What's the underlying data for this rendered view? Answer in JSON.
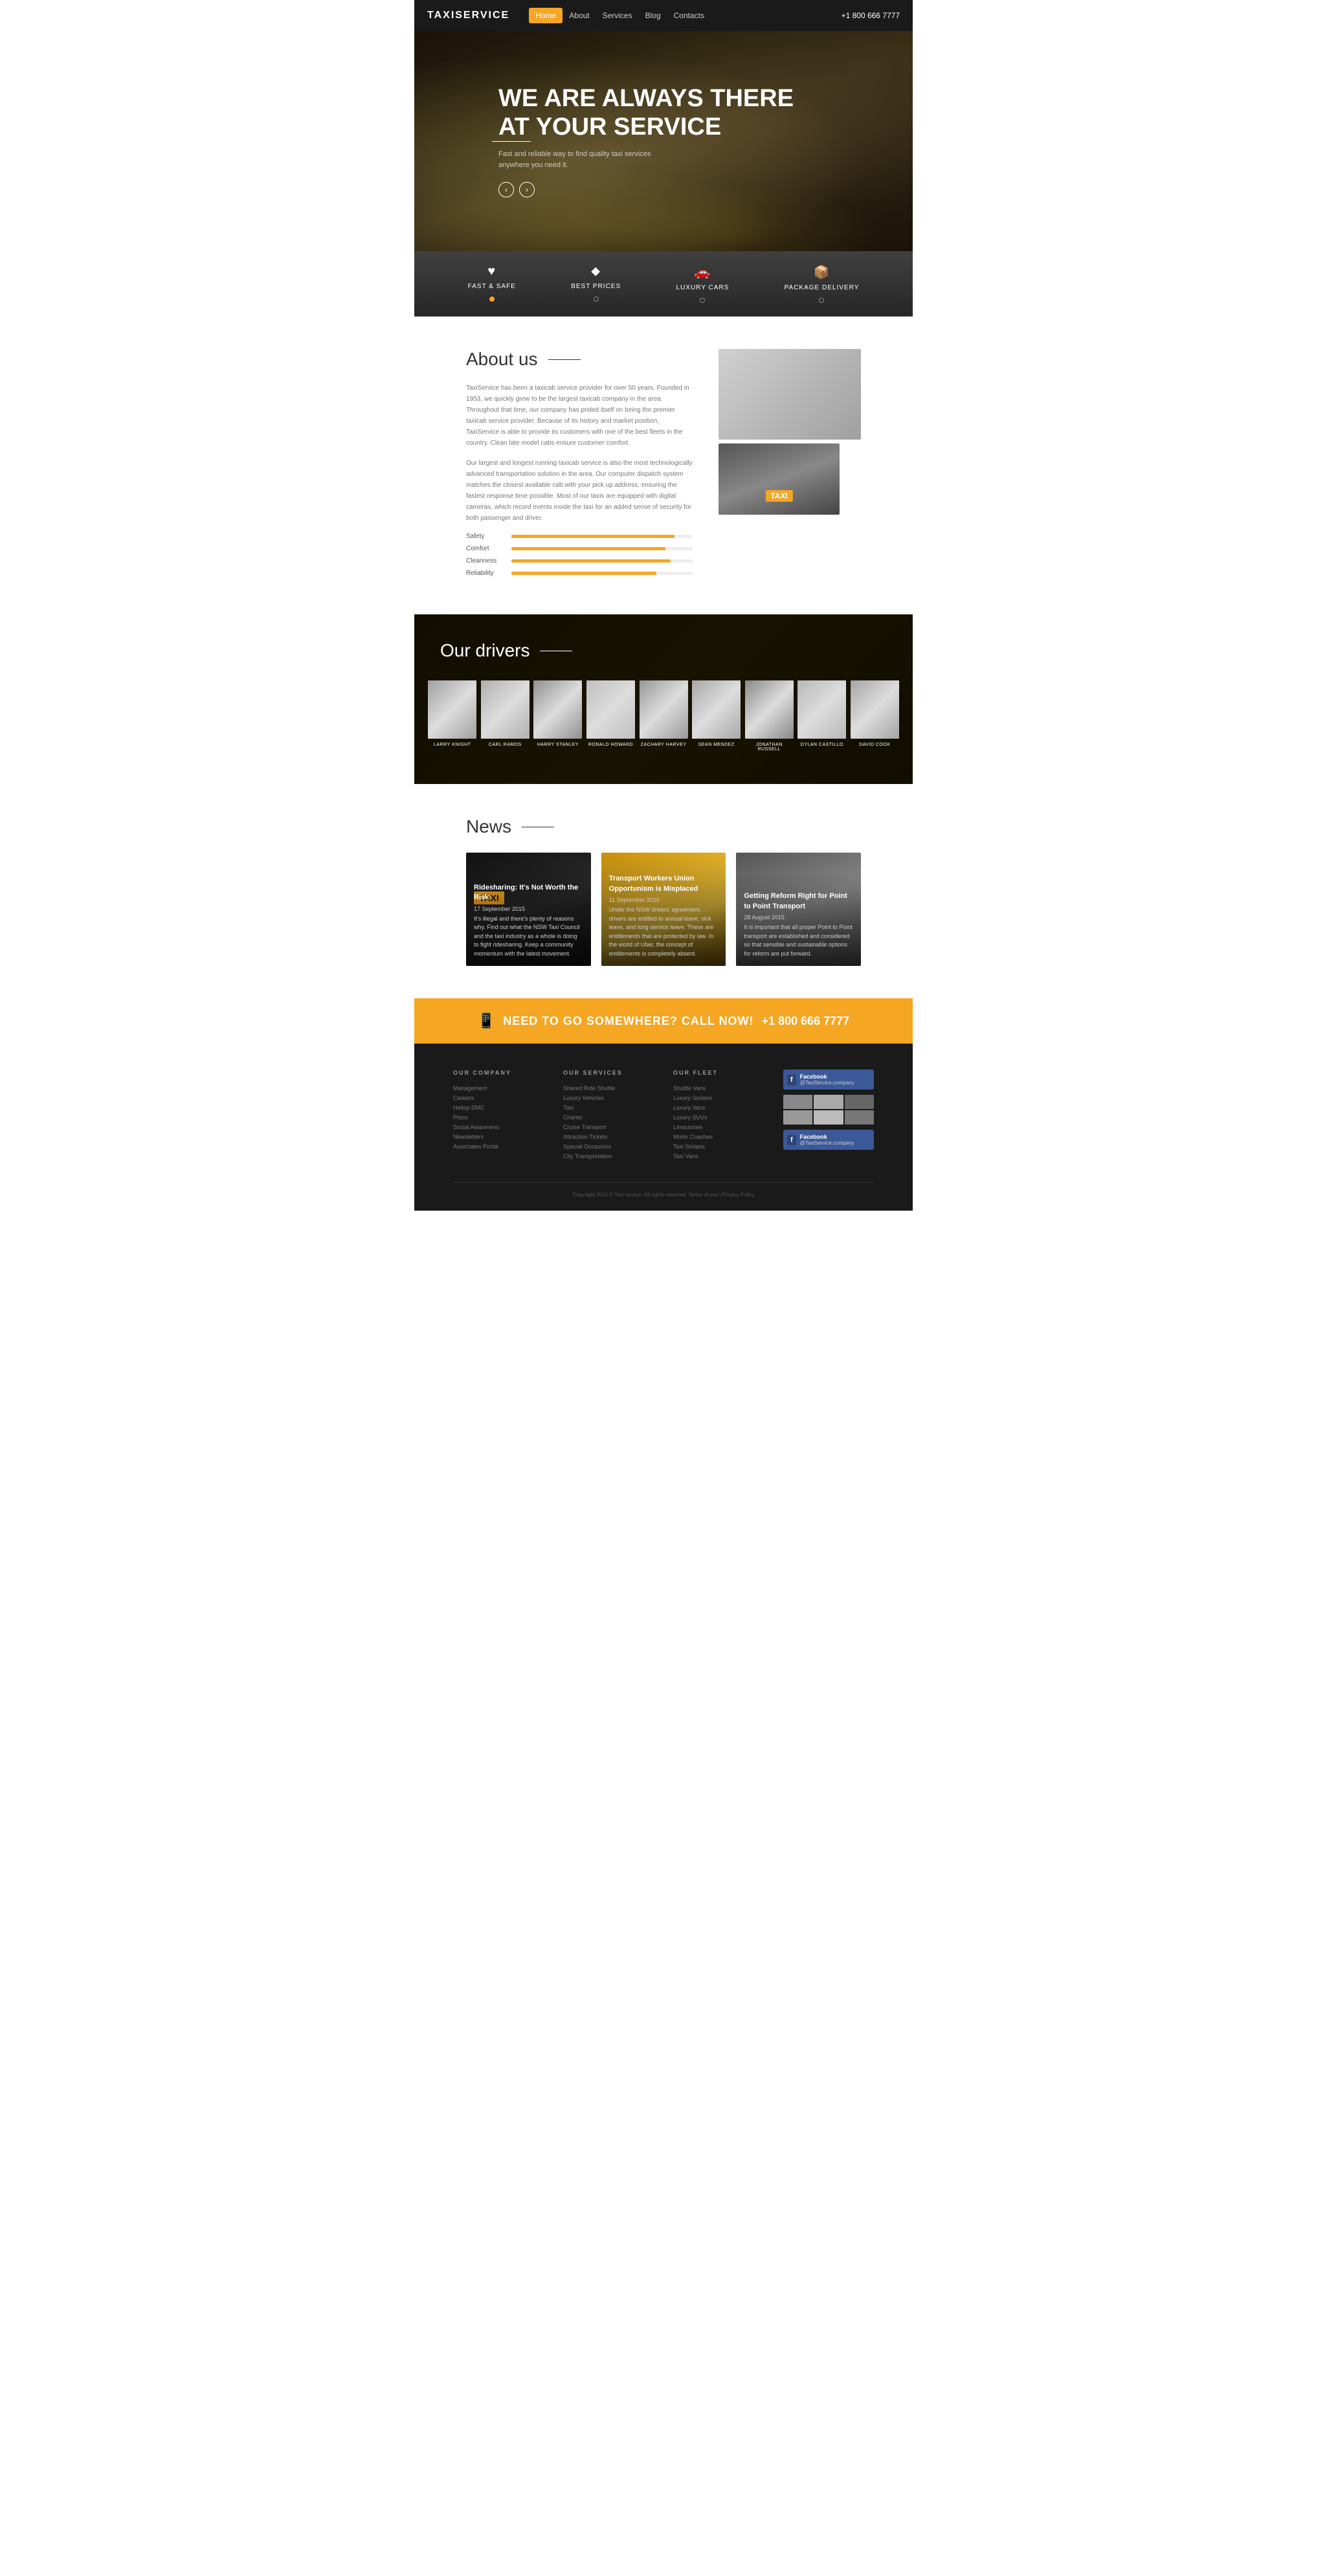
{
  "header": {
    "logo": "TAXISERVICE",
    "nav": [
      {
        "label": "Home",
        "active": true
      },
      {
        "label": "About",
        "active": false
      },
      {
        "label": "Services",
        "active": false
      },
      {
        "label": "Blog",
        "active": false
      },
      {
        "label": "Contacts",
        "active": false
      }
    ],
    "phone": "+1 800 666 7777"
  },
  "hero": {
    "headline_line1": "WE ARE ALWAYS THERE",
    "headline_line2": "AT YOUR SERVICE",
    "subtitle": "Fast and reliable way to find quality taxi services anywhere you need it.",
    "arrow_left": "‹",
    "arrow_right": "›"
  },
  "features": [
    {
      "icon": "♥",
      "label": "FAST & SAFE",
      "active": true
    },
    {
      "icon": "⬥",
      "label": "BEST PRICES",
      "active": false
    },
    {
      "icon": "🚗",
      "label": "LUXURY CARS",
      "active": false
    },
    {
      "icon": "📦",
      "label": "PACKAGE DELIVERY",
      "active": false
    }
  ],
  "about": {
    "title": "About us",
    "paragraphs": [
      "TaxiService has been a taxicab service provider for over 50 years. Founded in 1953, we quickly grew to be the largest taxicab company in the area. Throughout that time, our company has prided itself on being the premier taxicab service provider. Because of its history and market position, TaxiService is able to provide its customers with one of the best fleets in the country. Clean late model cabs ensure customer comfort.",
      "Our largest and longest running taxicab service is also the most technologically advanced transportation solution in the area. Our computer dispatch system matches the closest available cab with your pick up address, ensuring the fastest response time possible. Most of our taxis are equipped with digital cameras, which record events inside the taxi for an added sense of security for both passenger and driver."
    ],
    "skills": [
      {
        "label": "Safety",
        "value": 90
      },
      {
        "label": "Comfort",
        "value": 85
      },
      {
        "label": "Cleanness",
        "value": 88
      },
      {
        "label": "Reliability",
        "value": 80
      }
    ]
  },
  "drivers": {
    "title": "Our drivers",
    "list": [
      {
        "name": "LARRY KNIGHT"
      },
      {
        "name": "CARL RAMOS"
      },
      {
        "name": "HARRY STANLEY"
      },
      {
        "name": "RONALD HOWARD"
      },
      {
        "name": "ZACHARY HARVEY"
      },
      {
        "name": "SEAN MENDEZ"
      },
      {
        "name": "JONATHAN RUSSELL"
      },
      {
        "name": "DYLAN CASTILLO"
      },
      {
        "name": "DAVID COOK"
      }
    ]
  },
  "news": {
    "title": "News",
    "items": [
      {
        "title": "Ridesharing: It's Not Worth the Risk",
        "date": "17 September 2015",
        "excerpt": "It's illegal and there's plenty of reasons why. Find out what the NSW Taxi Council and the taxi industry as a whole is doing to fight ridesharing. Keep a community momentum with the latest movement.",
        "style": "dark"
      },
      {
        "title": "Transport Workers Union Opportunism is Misplaced",
        "date": "11 September 2015",
        "excerpt": "Under the NSW drivers' agreement, drivers are entitled to annual leave, sick leave, and long service leave. These are entitlements that are protected by law. In the world of Uber, the concept of entitlements is completely absent.",
        "style": "yellow"
      },
      {
        "title": "Getting Reform Right for Point to Point Transport",
        "date": "28 August 2015",
        "excerpt": "It is important that all proper Point to Point transport are established and considered so that sensible and sustainable options for reform are put forward.",
        "style": "medium"
      }
    ]
  },
  "cta": {
    "text": "NEED TO GO SOMEWHERE? CALL NOW!",
    "phone": "+1 800 666 7777"
  },
  "footer": {
    "company_heading": "OUR COMPANY",
    "company_links": [
      "Management",
      "Careers",
      "Helloр DMC",
      "Press",
      "Social Awareness",
      "Newsletters",
      "Associates Portal"
    ],
    "services_heading": "OUR SERVICES",
    "services_links": [
      "Shared Ride Shuttle",
      "Luxury Vehicles",
      "Taxi",
      "Charter",
      "Cruise Transport",
      "Attraction Tickets",
      "Special Occasions",
      "City Transportation"
    ],
    "fleet_heading": "OUR FLEET",
    "fleet_links": [
      "Shuttle Vans",
      "Luxury Sedans",
      "Luxury Vans",
      "Luxury SUVs",
      "Limousines",
      "Motor Coaches",
      "Taxi Sedans",
      "Taxi Vans"
    ],
    "facebook_name": "Facebook",
    "facebook_page": "@TaxiService.company",
    "copyright": "Copyright 2015 © Taxi service. All rights reserved. Terms of use | Privacy Policy"
  }
}
